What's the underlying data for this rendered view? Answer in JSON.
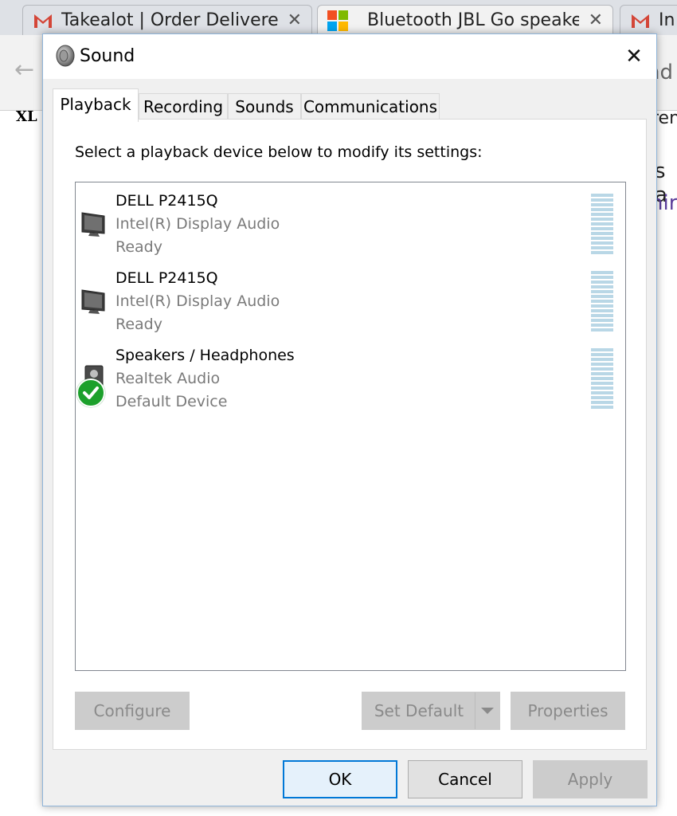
{
  "browser": {
    "tabs": [
      {
        "title": "Takealot | Order Delivered",
        "icon": "gmail-icon"
      },
      {
        "title": "Bluetooth JBL Go speaker",
        "icon": "microsoft-logo-icon"
      },
      {
        "title": "In",
        "icon": "gmail-icon"
      }
    ],
    "toolbar_fragment": "nd",
    "bookmark_fragment_left": "XL",
    "bookmark_fragment_right": "ren",
    "page_fragment_1": "s a",
    "page_fragment_2": "hir"
  },
  "dialog": {
    "title": "Sound",
    "tabs": [
      "Playback",
      "Recording",
      "Sounds",
      "Communications"
    ],
    "selected_tab": "Playback",
    "instruction": "Select a playback device below to modify its settings:",
    "devices": [
      {
        "name": "DELL P2415Q",
        "description": "Intel(R) Display Audio",
        "status": "Ready",
        "icon": "monitor-icon",
        "default": false
      },
      {
        "name": "DELL P2415Q",
        "description": "Intel(R) Display Audio",
        "status": "Ready",
        "icon": "monitor-icon",
        "default": false
      },
      {
        "name": "Speakers / Headphones",
        "description": "Realtek Audio",
        "status": "Default Device",
        "icon": "speaker-icon",
        "default": true
      }
    ],
    "buttons": {
      "configure": "Configure",
      "set_default": "Set Default",
      "properties": "Properties",
      "ok": "OK",
      "cancel": "Cancel",
      "apply": "Apply"
    },
    "colors": {
      "accent": "#0078d7",
      "default_check": "#1ca02b",
      "level_meter": "#b9d7e6"
    }
  }
}
